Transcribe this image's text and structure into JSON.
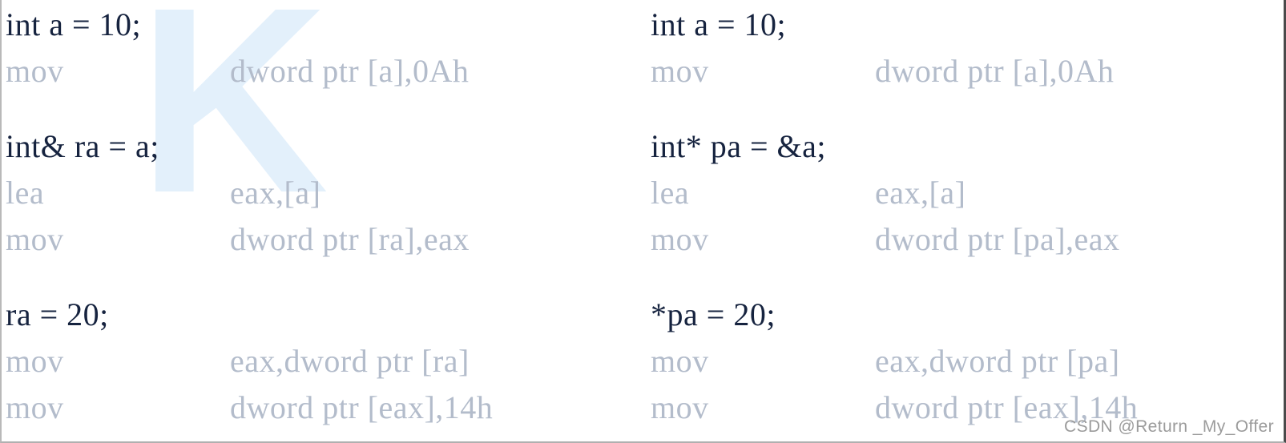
{
  "watermark": {
    "background_glyph": "K",
    "background_color": "#e3f0fb",
    "attribution": "CSDN @Return _My_Offer"
  },
  "colors": {
    "source_text": "#16233f",
    "assembly_text": "#b3bccb",
    "background": "#ffffff"
  },
  "columns": [
    {
      "id": "reference-column",
      "blocks": [
        {
          "source": "int a = 10;",
          "instructions": [
            {
              "mnemonic": "mov",
              "operands": "dword ptr [a],0Ah"
            }
          ]
        },
        {
          "source": "int& ra = a;",
          "instructions": [
            {
              "mnemonic": "lea",
              "operands": "eax,[a]"
            },
            {
              "mnemonic": "mov",
              "operands": "dword ptr [ra],eax"
            }
          ]
        },
        {
          "source": "ra = 20;",
          "instructions": [
            {
              "mnemonic": "mov",
              "operands": "eax,dword ptr [ra]"
            },
            {
              "mnemonic": "mov",
              "operands": "dword ptr [eax],14h"
            }
          ]
        }
      ]
    },
    {
      "id": "pointer-column",
      "blocks": [
        {
          "source": "int a = 10;",
          "instructions": [
            {
              "mnemonic": "mov",
              "operands": "dword ptr [a],0Ah"
            }
          ]
        },
        {
          "source": "int* pa = &a;",
          "instructions": [
            {
              "mnemonic": "lea",
              "operands": "eax,[a]"
            },
            {
              "mnemonic": "mov",
              "operands": "dword ptr [pa],eax"
            }
          ]
        },
        {
          "source": "*pa = 20;",
          "instructions": [
            {
              "mnemonic": "mov",
              "operands": "eax,dword ptr [pa]"
            },
            {
              "mnemonic": "mov",
              "operands": "dword ptr [eax],14h"
            }
          ]
        }
      ]
    }
  ]
}
